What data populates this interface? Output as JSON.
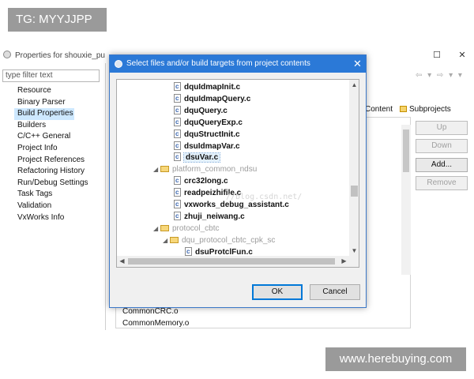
{
  "watermarks": {
    "top_left": "TG: MYYJJPP",
    "bottom_right": "www.herebuying.com",
    "tree_faint": "//blog.csdn.net/"
  },
  "properties_window": {
    "title": "Properties for shouxie_pu",
    "filter_placeholder": "type filter text",
    "nav_items": [
      "Resource",
      "Binary Parser",
      "Build Properties",
      "Builders",
      "C/C++ General",
      "Project Info",
      "Project References",
      "Refactoring History",
      "Run/Debug Settings",
      "Task Tags",
      "Validation",
      "VxWorks Info"
    ],
    "selected_nav": "Build Properties",
    "tabs": {
      "content": "Content",
      "subprojects": "Subprojects"
    },
    "buttons": {
      "up": "Up",
      "down": "Down",
      "add": "Add...",
      "remove": "Remove"
    },
    "files": [
      "CommonCRC.o",
      "CommonMemory.o"
    ],
    "window_buttons": {
      "maximize": "☐",
      "close": "✕"
    },
    "nav_arrows": "⇦ ▾ ⇨ ▾ ▾"
  },
  "dialog": {
    "title": "Select files and/or build targets from project contents",
    "close_glyph": "✕",
    "tree": [
      {
        "type": "file",
        "label": "dquIdmapInit.c"
      },
      {
        "type": "file",
        "label": "dquIdmapQuery.c"
      },
      {
        "type": "file",
        "label": "dquQuery.c"
      },
      {
        "type": "file",
        "label": "dquQueryExp.c"
      },
      {
        "type": "file",
        "label": "dquStructInit.c"
      },
      {
        "type": "file",
        "label": "dsuIdmapVar.c"
      },
      {
        "type": "file",
        "label": "dsuVar.c",
        "selected": true
      },
      {
        "type": "folder",
        "label": "platform_common_ndsu",
        "twist": "◢"
      },
      {
        "type": "file",
        "label": "crc32long.c"
      },
      {
        "type": "file",
        "label": "readpeizhifile.c"
      },
      {
        "type": "file",
        "label": "vxworks_debug_assistant.c"
      },
      {
        "type": "file",
        "label": "zhuji_neiwang.c"
      },
      {
        "type": "folder",
        "label": "protocol_cbtc",
        "twist": "◢"
      },
      {
        "type": "folder",
        "label": "dqu_protocol_cbtc_cpk_sc",
        "twist": "◢"
      },
      {
        "type": "file",
        "label": "dsuProtclFun.c"
      }
    ],
    "scroll_glyphs": {
      "up": "▲",
      "down": "▼",
      "left": "◀",
      "right": "▶"
    },
    "ok_label": "OK",
    "cancel_label": "Cancel"
  }
}
